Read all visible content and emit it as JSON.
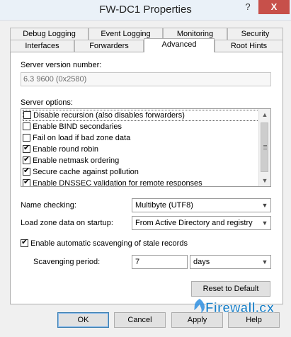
{
  "window": {
    "title": "FW-DC1 Properties",
    "help_label": "?",
    "close_label": "X"
  },
  "tabs": {
    "row1": [
      "Debug Logging",
      "Event Logging",
      "Monitoring",
      "Security"
    ],
    "row2": [
      "Interfaces",
      "Forwarders",
      "Advanced",
      "Root Hints"
    ],
    "active": "Advanced"
  },
  "advanced": {
    "server_version_label": "Server version number:",
    "server_version_value": "6.3 9600 (0x2580)",
    "server_options_label": "Server options:",
    "options": [
      {
        "label": "Disable recursion (also disables forwarders)",
        "checked": false
      },
      {
        "label": "Enable BIND secondaries",
        "checked": false
      },
      {
        "label": "Fail on load if bad zone data",
        "checked": false
      },
      {
        "label": "Enable round robin",
        "checked": true
      },
      {
        "label": "Enable netmask ordering",
        "checked": true
      },
      {
        "label": "Secure cache against pollution",
        "checked": true
      },
      {
        "label": "Enable DNSSEC validation for remote responses",
        "checked": true
      }
    ],
    "name_checking_label": "Name checking:",
    "name_checking_value": "Multibyte (UTF8)",
    "load_zone_label": "Load zone data on startup:",
    "load_zone_value": "From Active Directory and registry",
    "scavenging_checkbox_label": "Enable automatic scavenging of stale records",
    "scavenging_enabled": true,
    "scavenging_period_label": "Scavenging period:",
    "scavenging_period_value": "7",
    "scavenging_unit_value": "days",
    "reset_label": "Reset to Default"
  },
  "footer": {
    "ok_label": "OK",
    "cancel_label": "Cancel",
    "apply_label": "Apply",
    "help_label": "Help"
  },
  "watermark": {
    "text": "Firewall.cx",
    "color": "#1a7fc7"
  }
}
